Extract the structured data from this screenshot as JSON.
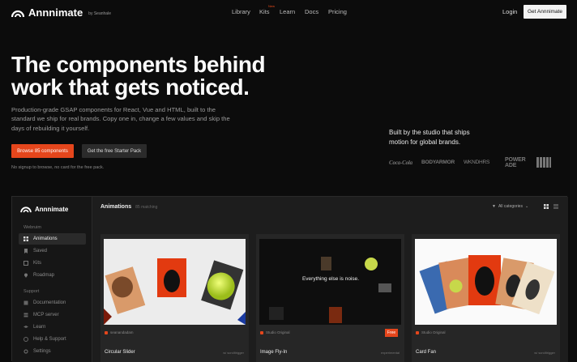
{
  "nav": {
    "brand": "Annnimate",
    "brand_by": "by Seanhale",
    "menu": [
      "Library",
      "Kits",
      "Learn",
      "Docs",
      "Pricing"
    ],
    "kits_badge": "New",
    "login": "Login",
    "cta": "Get Annnimate"
  },
  "hero": {
    "title": "The components behind work that gets noticed.",
    "description": "Production-grade GSAP components for React, Vue and HTML, built to the standard we ship for real brands. Copy one in, change a few values and skip the days of rebuilding it yourself.",
    "primary_button": "Browse 85 components",
    "secondary_button": "Get the free Starter Pack",
    "fine_print": "No signup to browse, no card for the free pack.",
    "studio_text": "Built by the studio that ships motion for global brands.",
    "brands": [
      "Coca-Cola",
      "BODYARMOR",
      "WKNDHRS",
      "POWER ADE",
      "ESPN"
    ]
  },
  "app": {
    "brand": "Annnimate",
    "sections": {
      "main": "Webruim",
      "support": "Support"
    },
    "sidebar_main": [
      {
        "label": "Animations",
        "icon": "grid-icon",
        "active": true
      },
      {
        "label": "Saved",
        "icon": "bookmark-icon"
      },
      {
        "label": "Kits",
        "icon": "box-icon"
      },
      {
        "label": "Roadmap",
        "icon": "pin-icon"
      }
    ],
    "sidebar_support": [
      {
        "label": "Documentation",
        "icon": "book-icon"
      },
      {
        "label": "MCP server",
        "icon": "server-icon"
      },
      {
        "label": "Learn",
        "icon": "cap-icon"
      },
      {
        "label": "Help & Support",
        "icon": "help-icon"
      },
      {
        "label": "Settings",
        "icon": "gear-icon"
      }
    ],
    "header": {
      "title": "Animations",
      "count": "85 matching",
      "filter": "All categories"
    },
    "cards": [
      {
        "title": "Circular Slider",
        "meta": "seanandadam",
        "tag": "w/ scrolltrigger"
      },
      {
        "title": "Image Fly-In",
        "meta": "Studio Original",
        "tag": "experimental",
        "badge": "Free",
        "overlay": "Everything else is noise."
      },
      {
        "title": "Card Fan",
        "meta": "Studio Original",
        "tag": "w/ scrolltrigger"
      }
    ]
  },
  "colors": {
    "accent": "#e5461c",
    "bg": "#0c0c0c"
  }
}
